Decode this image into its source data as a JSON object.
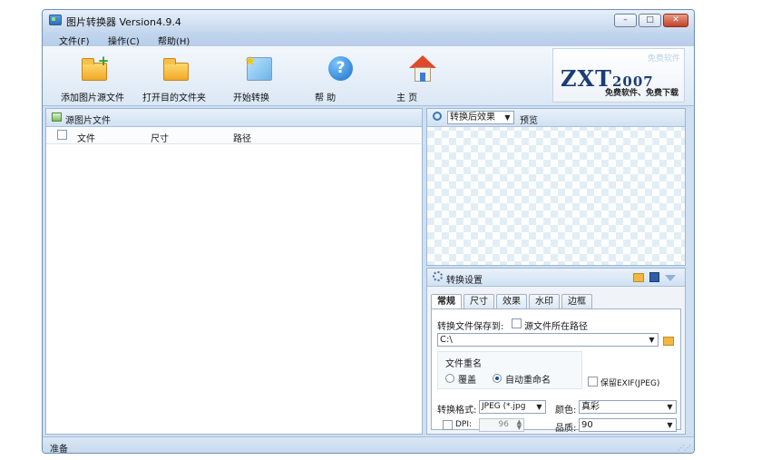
{
  "window": {
    "title": "图片转换器 Version4.9.4",
    "controls": {
      "minimize": "–",
      "maximize": "□",
      "close": "✕"
    }
  },
  "menu": [
    {
      "label": "文件(F)"
    },
    {
      "label": "操作(C)"
    },
    {
      "label": "帮助(H)"
    }
  ],
  "toolbar": {
    "add_source": "添加图片源文件",
    "open_target": "打开目的文件夹",
    "start": "开始转换",
    "help": "帮 助",
    "home": "主 页",
    "help_glyph": "?"
  },
  "logo": {
    "brand": "ZXT",
    "year": "2007",
    "slogan": "免费软件、免费下载",
    "faint_text": "免费软件"
  },
  "source_panel": {
    "title": "源图片文件",
    "columns": [
      "文件",
      "尺寸",
      "路径"
    ]
  },
  "preview_panel": {
    "mode_select": "转换后效果",
    "label": "预览"
  },
  "settings": {
    "title": "转换设置",
    "tabs": [
      "常规",
      "尺寸",
      "效果",
      "水印",
      "边框"
    ],
    "save_to_label": "转换文件保存到:",
    "source_path_checkbox": "源文件所在路径",
    "save_path": "C:\\",
    "rename_group": "文件重名",
    "overwrite": "覆盖",
    "auto_rename": "自动重命名",
    "keep_exif": "保留EXIF(JPEG)",
    "format_label": "转换格式:",
    "format_value": "JPEG (*.jpg",
    "color_label": "颜色:",
    "color_value": "真彩",
    "dpi_label": "DPI:",
    "dpi_value": "96",
    "quality_label": "品质:",
    "quality_value": "90"
  },
  "status": {
    "text": "准备"
  },
  "colors": {
    "window_bg": "#cfe0f3",
    "border": "#6f8fb3",
    "close_button": "#c3422a",
    "logo_text": "#1c3d73"
  }
}
